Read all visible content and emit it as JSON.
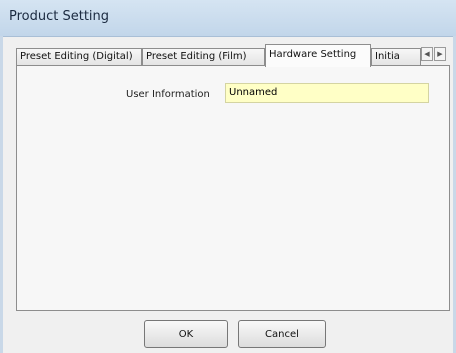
{
  "window": {
    "title": "Product Setting"
  },
  "tabs": [
    {
      "label": "Preset Editing (Digital)",
      "active": false
    },
    {
      "label": "Preset Editing (Film)",
      "active": false
    },
    {
      "label": "Hardware Setting",
      "active": true
    },
    {
      "label": "Initia",
      "active": false
    }
  ],
  "tab_scroll": {
    "left_icon": "arrow-left-icon",
    "right_icon": "arrow-right-icon"
  },
  "fields": {
    "user_information": {
      "label": "User Information",
      "value": "Unnamed"
    }
  },
  "buttons": {
    "ok": "OK",
    "cancel": "Cancel"
  },
  "colors": {
    "input_bg": "#ffffc6",
    "titlebar": "#c9d9ea"
  }
}
